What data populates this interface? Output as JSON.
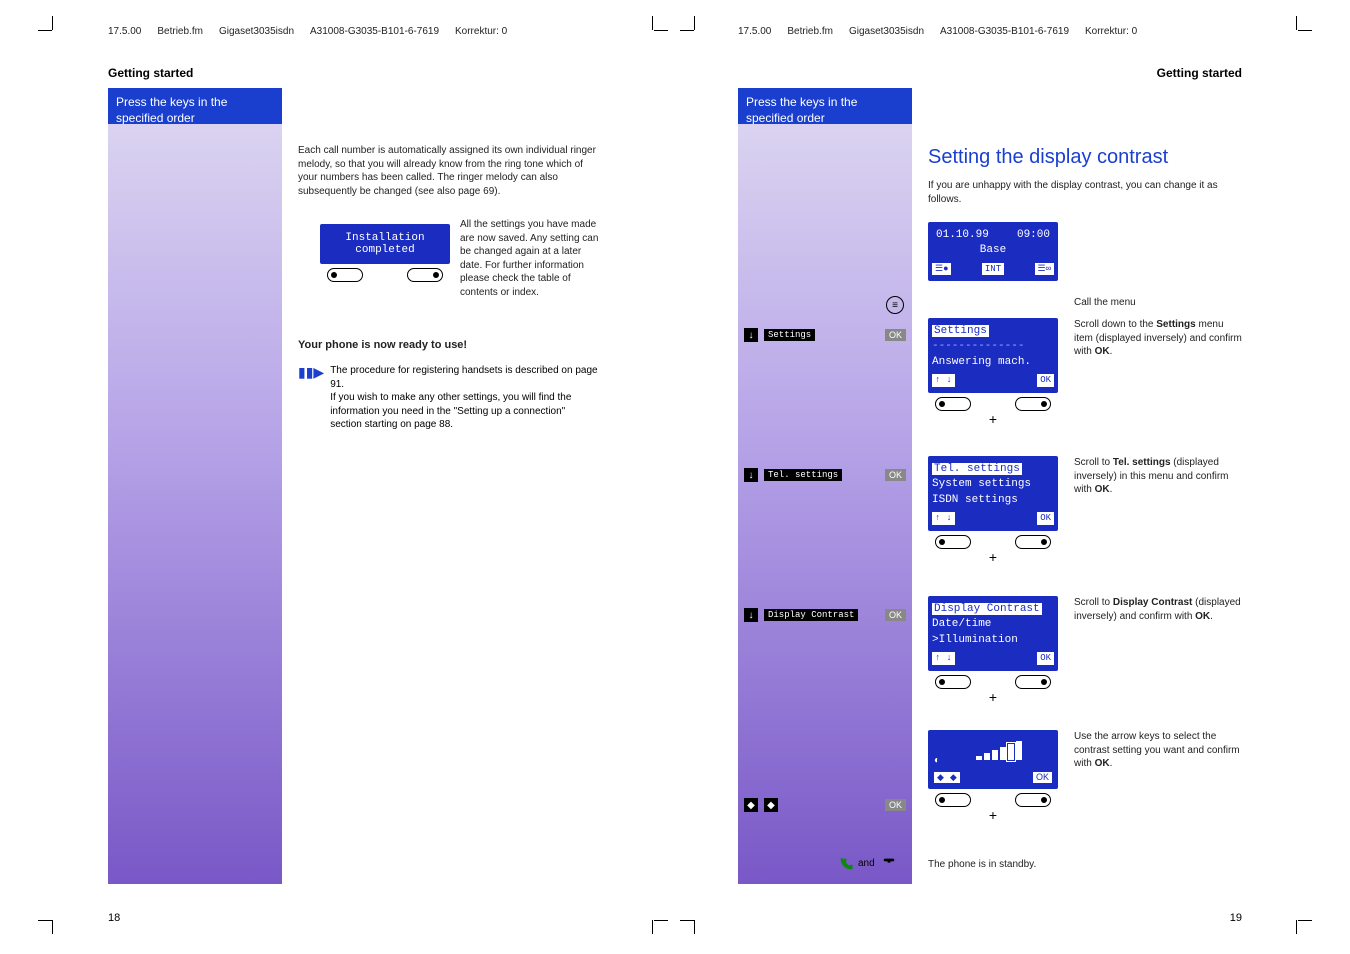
{
  "header_left": {
    "date": "17.5.00",
    "file": "Betrieb.fm",
    "model": "Gigaset3035isdn",
    "code": "A31008-G3035-B101-6-7619",
    "korr": "Korrektur: 0"
  },
  "header_right": {
    "date": "17.5.00",
    "file": "Betrieb.fm",
    "model": "Gigaset3035isdn",
    "code": "A31008-G3035-B101-6-7619",
    "korr": "Korrektur: 0"
  },
  "section_left": "Getting started",
  "section_right": "Getting started",
  "bluebox": "Press the keys in the specified order",
  "left": {
    "intro": "Each call number is automatically assigned its own individual ringer melody, so that you will already know from the ring tone which of your numbers has been called. The ringer melody can also subsequently be changed (see also page 69).",
    "lcd_line1": "Installation",
    "lcd_line2": "completed",
    "saved": "All the settings you have made are now saved. Any setting can be changed again at a later date. For further information please check the table of contents or index.",
    "ready": "Your phone is now ready to use!",
    "note1": "The procedure for registering handsets is described on page 91.",
    "note2": "If you wish to make any other settings, you will find the information you need in the \"Setting up a connection\" section starting on page 88."
  },
  "right": {
    "title": "Setting the display contrast",
    "intro": "If you are unhappy with the display contrast, you can change it as follows.",
    "lcd_home": {
      "date": "01.10.99",
      "time": "09:00",
      "name": "Base",
      "int": "INT"
    },
    "menu_call": "Call the menu",
    "step1": {
      "label": "Settings",
      "ok": "OK",
      "scr_hi": "Settings",
      "scr_2": "Answering mach.",
      "desc_pre": "Scroll down to the ",
      "desc_b": "Settings",
      "desc_post": " menu item (displayed inversely) and confirm with ",
      "desc_ok": "OK"
    },
    "step2": {
      "label": "Tel. settings",
      "ok": "OK",
      "scr_hi": "Tel. settings",
      "scr_2": "System settings",
      "scr_3": "ISDN settings",
      "desc_pre": "Scroll to ",
      "desc_b": "Tel. settings",
      "desc_post": " (displayed inversely) in this menu and confirm with ",
      "desc_ok": "OK"
    },
    "step3": {
      "label": "Display Contrast",
      "ok": "OK",
      "scr_hi": "Display Contrast",
      "scr_2": "Date/time",
      "scr_3": ">Illumination",
      "desc_pre": "Scroll to ",
      "desc_b": "Display Contrast",
      "desc_post": " (displayed inversely) and confirm with ",
      "desc_ok": "OK"
    },
    "step4": {
      "ok": "OK",
      "desc": "Use the arrow keys to select the contrast setting you want and confirm with ",
      "desc_ok": "OK"
    },
    "standby_and": "and",
    "standby": "The phone is in standby."
  },
  "page_left": "18",
  "page_right": "19"
}
